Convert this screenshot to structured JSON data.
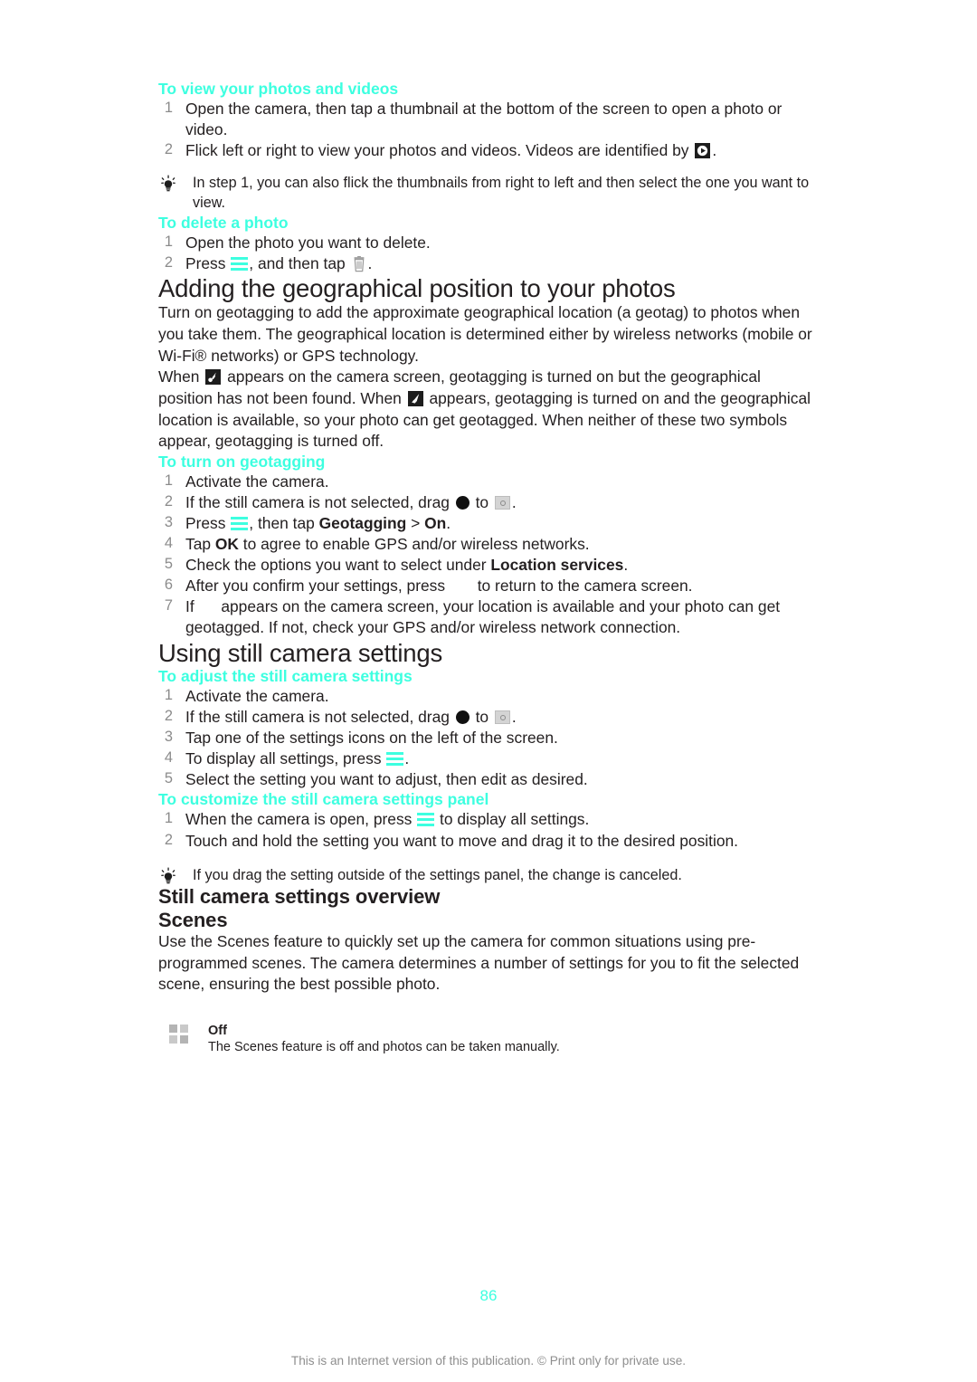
{
  "document": {
    "page_number": "86",
    "footer_note": "This is an Internet version of this publication. © Print only for private use.",
    "accent_color": "#3dffe0",
    "text_color": "#231f20",
    "step_number_color": "#8b8b8b"
  },
  "procedures": {
    "view_photos": {
      "heading": "To view your photos and videos",
      "steps": [
        {
          "before": "Open the camera, then tap a thumbnail at the bottom of the screen to open a photo or video.",
          "icon": null,
          "after": ""
        },
        {
          "before": "Flick left or right to view your photos and videos. Videos are identified by ",
          "icon": "video-play-icon",
          "after": "."
        }
      ],
      "tip": "In step 1, you can also flick the thumbnails from right to left and then select the one you want to view."
    },
    "delete_photo": {
      "heading": "To delete a photo",
      "steps": [
        {
          "before": "Open the photo you want to delete.",
          "icon": null,
          "after": ""
        },
        {
          "before": "Press ",
          "icon": "menu-icon",
          "mid": ", and then tap ",
          "icon2": "trash-icon",
          "after": "."
        }
      ]
    },
    "turn_on_geotagging": {
      "heading": "To turn on geotagging",
      "steps": [
        {
          "text": "Activate the camera."
        },
        {
          "before": "If the still camera is not selected, drag ",
          "icon": "drag-dot-icon",
          "mid": " to ",
          "icon2": "still-camera-icon",
          "after": "."
        },
        {
          "before": "Press ",
          "icon": "menu-icon",
          "mid": ", then tap ",
          "bold1": "Geotagging",
          "sep": " > ",
          "bold2": "On",
          "after": "."
        },
        {
          "before": "Tap ",
          "bold1": "OK",
          "after": " to agree to enable GPS and/or wireless networks."
        },
        {
          "before": "Check the options you want to select under ",
          "bold1": "Location services",
          "after": "."
        },
        {
          "before": "After you confirm your settings, press ",
          "icon": "missing-glyph",
          "after": " to return to the camera screen."
        },
        {
          "before": "If ",
          "icon": "missing-glyph",
          "after": " appears on the camera screen, your location is available and your photo can get geotagged. If not, check your GPS and/or wireless network connection."
        }
      ]
    },
    "adjust_still_camera": {
      "heading": "To adjust the still camera settings",
      "steps": [
        {
          "text": "Activate the camera."
        },
        {
          "before": "If the still camera is not selected, drag ",
          "icon": "drag-dot-icon",
          "mid": " to ",
          "icon2": "still-camera-icon",
          "after": "."
        },
        {
          "text": "Tap one of the settings icons on the left of the screen."
        },
        {
          "before": "To display all settings, press ",
          "icon": "menu-icon",
          "after": "."
        },
        {
          "text": "Select the setting you want to adjust, then edit as desired."
        }
      ]
    },
    "customize_panel": {
      "heading": "To customize the still camera settings panel",
      "steps": [
        {
          "before": "When the camera is open, press ",
          "icon": "menu-icon",
          "after": " to display all settings."
        },
        {
          "text": "Touch and hold the setting you want to move and drag it to the desired position."
        }
      ],
      "tip": "If you drag the setting outside of the settings panel, the change is canceled."
    }
  },
  "headings": {
    "geographical_position": "Adding the geographical position to your photos",
    "using_still_camera_settings": "Using still camera settings",
    "still_camera_settings_overview": "Still camera settings overview",
    "scenes": "Scenes"
  },
  "paragraphs": {
    "geotagging_intro": "Turn on geotagging to add the approximate geographical location (a geotag) to photos when you take them. The geographical location is determined either by wireless networks (mobile or Wi-Fi® networks) or GPS technology.",
    "geotagging_symbols_p1": "When ",
    "geotagging_symbols_p2": " appears on the camera screen, geotagging is turned on but the geographical position has not been found. When ",
    "geotagging_symbols_p3": " appears, geotagging is turned on and the geographical location is available, so your photo can get geotagged. When neither of these two symbols appear, geotagging is turned off.",
    "scenes_intro": "Use the Scenes feature to quickly set up the camera for common situations using pre-programmed scenes. The camera determines a number of settings for you to fit the selected scene, ensuring the best possible photo."
  },
  "scenes_settings": [
    {
      "icon": "grid-off-icon",
      "name": "Off",
      "description": "The Scenes feature is off and photos can be taken manually."
    }
  ]
}
